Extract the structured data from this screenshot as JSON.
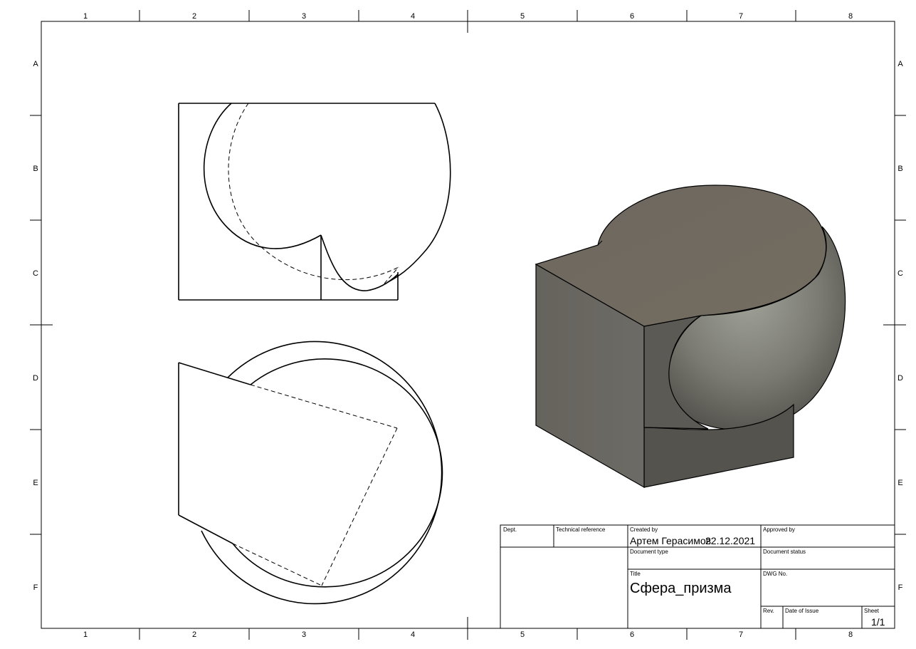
{
  "zones": {
    "columns": [
      "1",
      "2",
      "3",
      "4",
      "5",
      "6",
      "7",
      "8"
    ],
    "rows": [
      "A",
      "B",
      "C",
      "D",
      "E",
      "F"
    ]
  },
  "title_block": {
    "dept_label": "Dept.",
    "technical_reference_label": "Technical reference",
    "created_by_label": "Created by",
    "created_by_value": "Артем Герасимов",
    "created_date": "22.12.2021",
    "approved_by_label": "Approved by",
    "document_type_label": "Document type",
    "document_status_label": "Document status",
    "title_label": "Title",
    "title_value": "Сфера_призма",
    "dwg_no_label": "DWG No.",
    "rev_label": "Rev.",
    "date_of_issue_label": "Date of Issue",
    "sheet_label": "Sheet",
    "sheet_value": "1/1"
  },
  "colors": {
    "line": "#000000",
    "model_top": "#6f6a5f",
    "model_side": "#55534d",
    "model_front": "#64615b",
    "sphere_light": "#9a9c92",
    "sphere_dark": "#4d4c47"
  }
}
